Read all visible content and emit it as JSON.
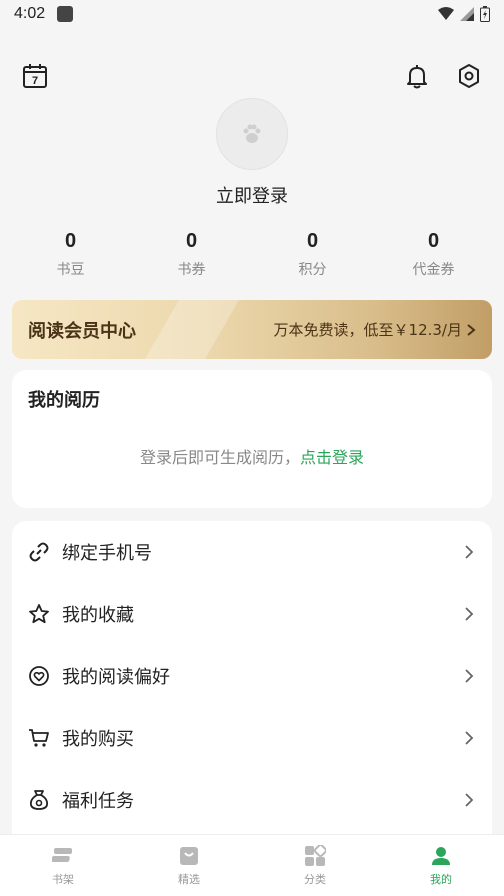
{
  "status_bar": {
    "time": "4:02"
  },
  "header": {
    "calendar_day": "7"
  },
  "profile": {
    "login_title": "立即登录"
  },
  "stats": [
    {
      "value": "0",
      "label": "书豆"
    },
    {
      "value": "0",
      "label": "书券"
    },
    {
      "value": "0",
      "label": "积分"
    },
    {
      "value": "0",
      "label": "代金券"
    }
  ],
  "vip_banner": {
    "title": "阅读会员中心",
    "subtitle": "万本免费读，低至￥12.3/月"
  },
  "history": {
    "title": "我的阅历",
    "text": "登录后即可生成阅历，",
    "link": "点击登录"
  },
  "menu": [
    {
      "label": "绑定手机号",
      "icon": "link-icon"
    },
    {
      "label": "我的收藏",
      "icon": "star-icon"
    },
    {
      "label": "我的阅读偏好",
      "icon": "heart-icon"
    },
    {
      "label": "我的购买",
      "icon": "cart-icon"
    },
    {
      "label": "福利任务",
      "icon": "gift-bag-icon"
    }
  ],
  "tabbar": [
    {
      "label": "书架",
      "icon": "bookshelf-icon",
      "active": false
    },
    {
      "label": "精选",
      "icon": "shopping-bag-icon",
      "active": false
    },
    {
      "label": "分类",
      "icon": "category-grid-icon",
      "active": false
    },
    {
      "label": "我的",
      "icon": "user-icon",
      "active": true
    }
  ],
  "colors": {
    "accent": "#2aa55a",
    "background": "#f5f5f5",
    "vip_text": "#4a3316"
  }
}
